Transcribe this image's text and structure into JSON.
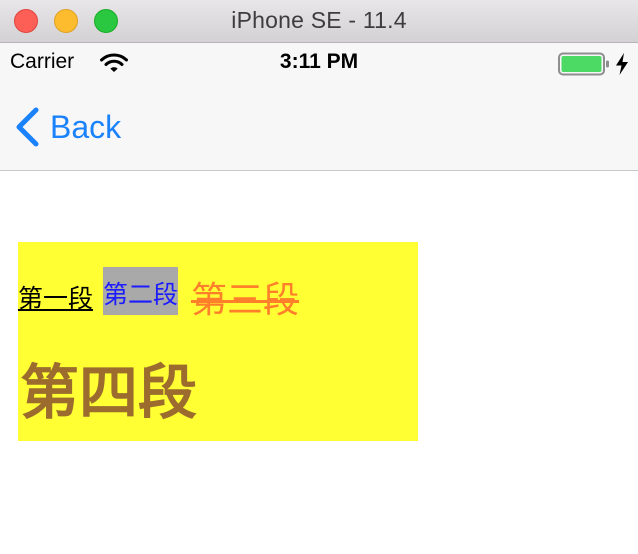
{
  "window": {
    "title": "iPhone SE - 11.4"
  },
  "status_bar": {
    "carrier": "Carrier",
    "time": "3:11 PM"
  },
  "nav": {
    "back_label": "Back"
  },
  "content": {
    "segment1": "第一段",
    "segment2": "第二段",
    "segment3": "第三段",
    "segment4": "第四段"
  },
  "colors": {
    "accent": "#1a82fb",
    "box_background": "#ffff33",
    "segment2_text": "#1c1cff",
    "segment2_highlight": "#a9a9a9",
    "segment3_text": "#ff7f2a",
    "segment4_text": "#9b6c2e",
    "battery": "#4cd964"
  },
  "icons": [
    "close-button",
    "minimize-button",
    "zoom-button",
    "wifi-icon",
    "battery-icon",
    "charging-icon",
    "back-chevron-icon"
  ]
}
